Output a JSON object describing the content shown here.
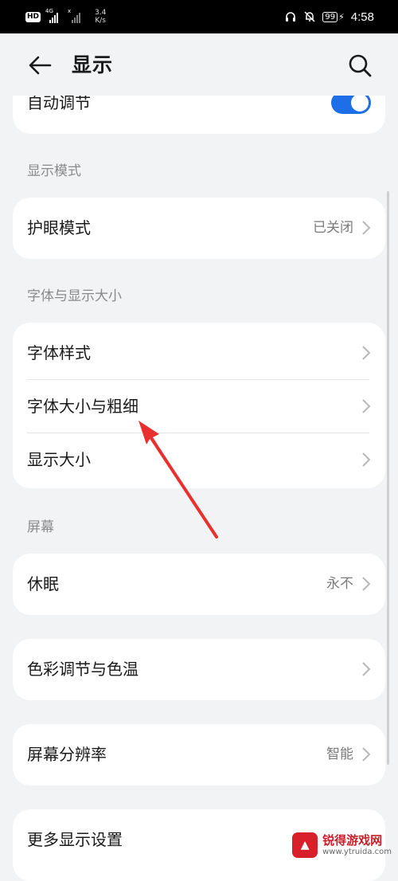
{
  "status_bar": {
    "hd_badge": "HD",
    "network_4g": "4G",
    "network_x": "x",
    "speed_value": "3.4",
    "speed_unit": "K/s",
    "battery": "99",
    "time": "4:58",
    "icons": [
      "hd-icon",
      "signal-icon",
      "signal-icon",
      "headphones-icon",
      "bell-off-icon",
      "battery-icon",
      "charging-icon"
    ]
  },
  "header": {
    "title": "显示",
    "back_icon": "back-arrow-icon",
    "search_icon": "search-icon"
  },
  "top_card": {
    "label": "自动调节",
    "toggle_on": true
  },
  "sections": {
    "display_mode": "显示模式",
    "font_size": "字体与显示大小",
    "screen": "屏幕"
  },
  "rows": {
    "eye_comfort": {
      "label": "护眼模式",
      "value": "已关闭"
    },
    "font_style": {
      "label": "字体样式"
    },
    "font_size_weight": {
      "label": "字体大小与粗细"
    },
    "display_size": {
      "label": "显示大小"
    },
    "sleep": {
      "label": "休眠",
      "value": "永不"
    },
    "color_temp": {
      "label": "色彩调节与色温"
    },
    "resolution": {
      "label": "屏幕分辨率",
      "value": "智能"
    },
    "more_settings": {
      "label": "更多显示设置"
    }
  },
  "colors": {
    "accent": "#1e6ee8",
    "annotation_arrow": "#e8312e",
    "background": "#f1f3f5"
  },
  "watermark": {
    "name": "锐得游戏网",
    "url": "www.ytruida.com"
  }
}
